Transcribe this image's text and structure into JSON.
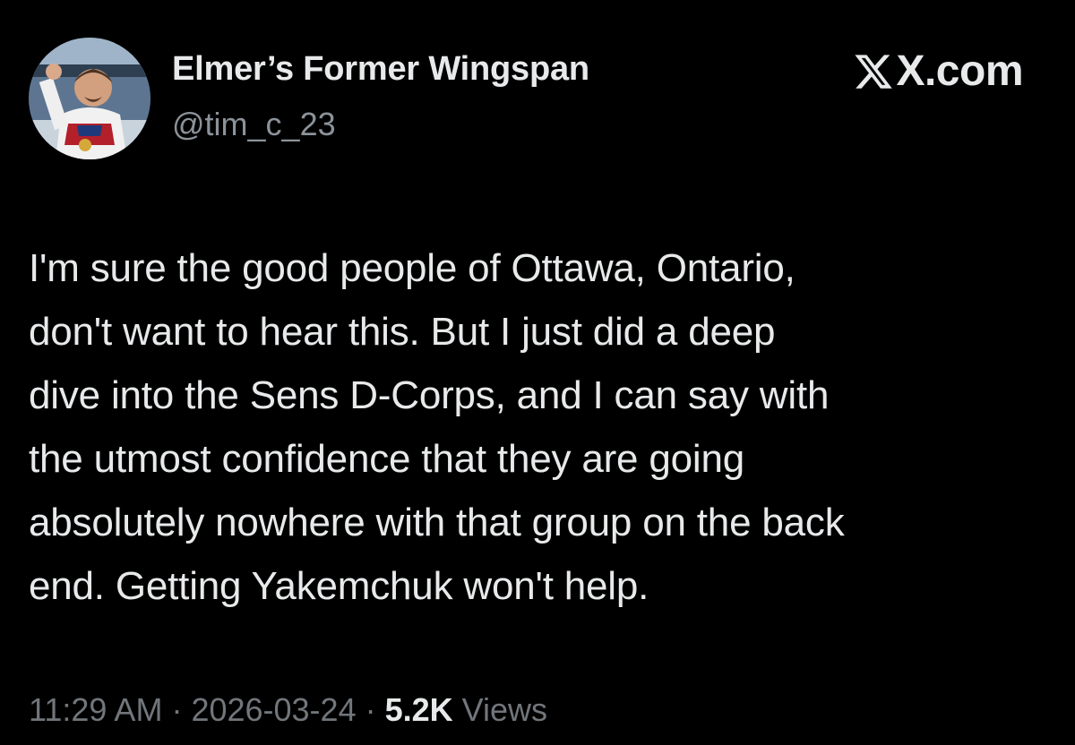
{
  "header": {
    "display_name": "Elmer’s Former Wingspan",
    "handle": "@tim_c_23",
    "brand": "X.com",
    "brand_icon": "x-logo-icon"
  },
  "tweet": {
    "text": "I'm sure the good people of Ottawa, Ontario,\ndon't want to hear this. But I just did a deep\ndive into the Sens D-Corps, and I can say with\nthe utmost confidence that they are going\nabsolutely nowhere with that group on the back\nend. Getting Yakemchuk won't help."
  },
  "meta": {
    "time": "11:29 AM",
    "separator": " · ",
    "date": "2026-03-24",
    "views_count": "5.2K",
    "views_label": " Views"
  },
  "colors": {
    "background": "#000000",
    "primary_text": "#e7e9ea",
    "secondary_text": "#71767b"
  }
}
